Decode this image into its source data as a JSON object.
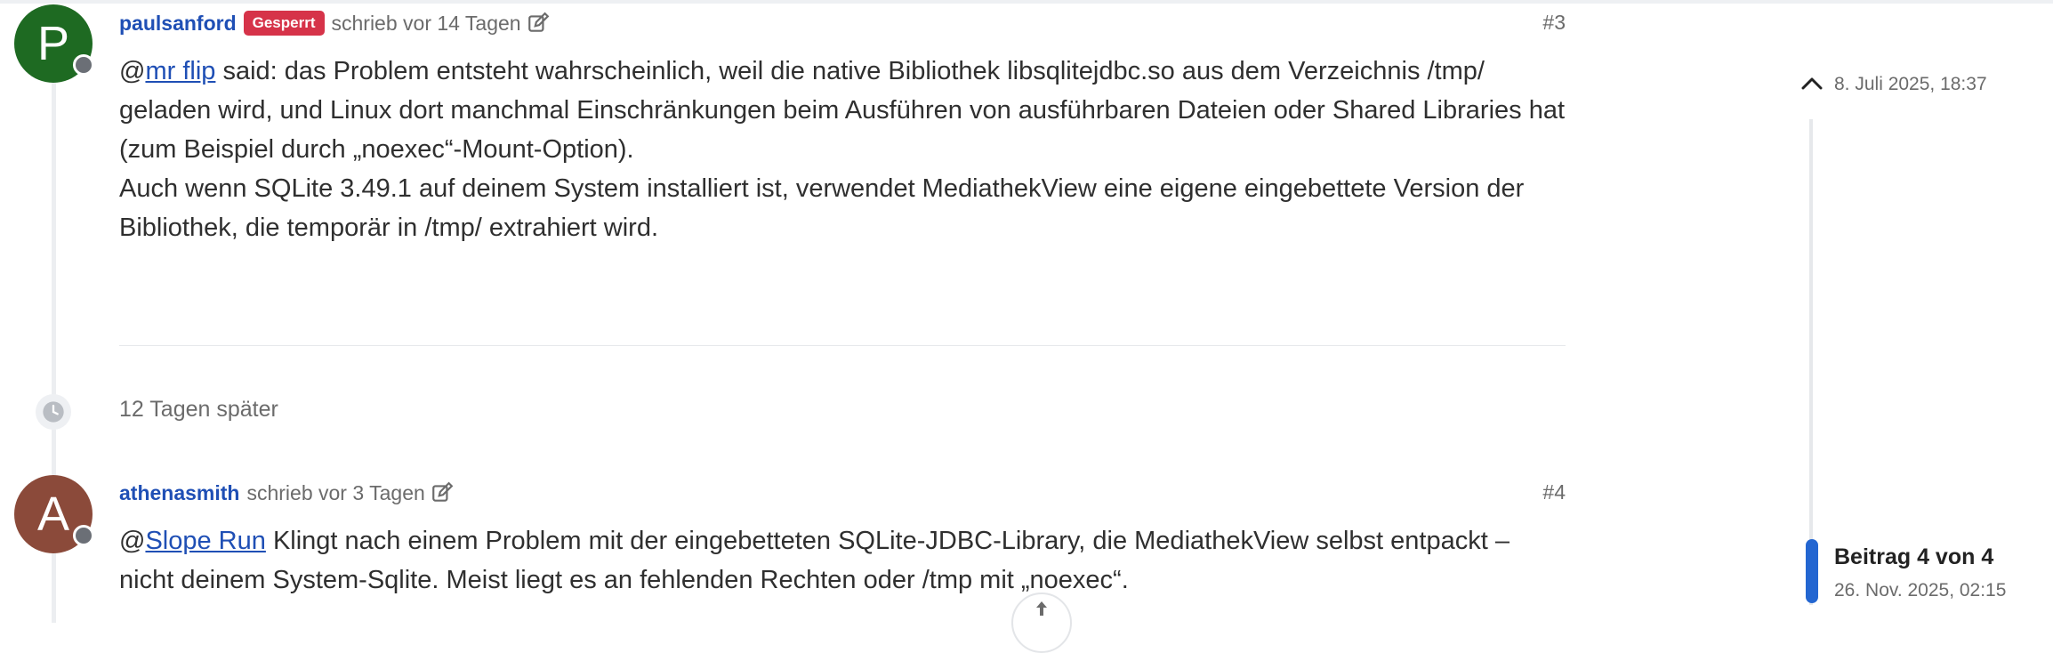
{
  "posts": [
    {
      "avatar_letter": "P",
      "avatar_color": "#1e6a22",
      "username": "paulsanford",
      "badge": "Gesperrt",
      "meta": "schrieb vor 14 Tagen",
      "number": "#3",
      "mention": "mr flip",
      "line1_prefix": "@",
      "line1_rest": " said: das Problem entsteht wahrscheinlich, weil die native Bibliothek libsqlitejdbc.so aus dem Verzeichnis /tmp/ geladen wird, und Linux dort manchmal Einschränkungen beim Ausführen von ausführbaren Dateien oder Shared Libraries hat (zum Beispiel durch „noexec“-Mount-Option).",
      "paragraph2": "Auch wenn SQLite 3.49.1 auf deinem System installiert ist, verwendet MediathekView eine eigene eingebettete Version der Bibliothek, die temporär in /tmp/ extrahiert wird."
    },
    {
      "avatar_letter": "A",
      "avatar_color": "#8b4a3a",
      "username": "athenasmith",
      "meta": "schrieb vor 3 Tagen",
      "number": "#4",
      "mention": "Slope Run",
      "line1_prefix": "@",
      "line1_rest": " Klingt nach einem Problem mit der eingebetteten SQLite-JDBC-Library, die MediathekView selbst entpackt – nicht deinem System-Sqlite. Meist liegt es an fehlenden Rechten oder /tmp mit „noexec“."
    }
  ],
  "time_gap": "12 Tagen später",
  "scrubber": {
    "top_date": "8. Juli 2025, 18:37",
    "position": "Beitrag 4 von 4",
    "current_date": "26. Nov. 2025, 02:15",
    "accent": "#2366d1"
  },
  "icons": {
    "edit": "edit-icon",
    "clock": "clock-icon",
    "chevron": "chevron-up-icon",
    "arrow": "arrow-up-icon"
  }
}
